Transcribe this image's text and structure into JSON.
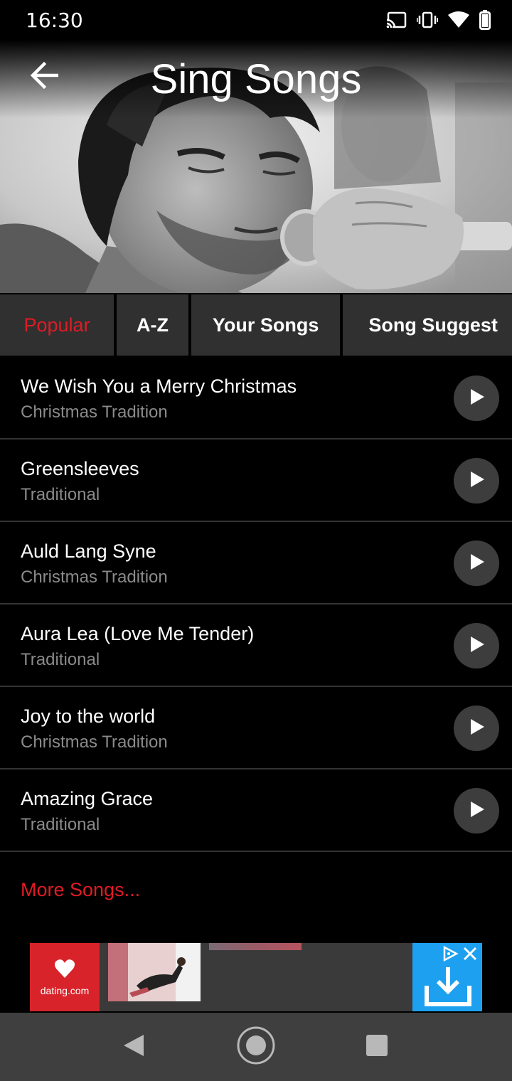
{
  "status_bar": {
    "time": "16:30",
    "icons": [
      "cast-icon",
      "vibrate-icon",
      "wifi-icon",
      "battery-icon"
    ]
  },
  "header": {
    "title": "Sing Songs",
    "back_icon": "arrow-back-icon"
  },
  "tabs": [
    {
      "label": "Popular",
      "active": true
    },
    {
      "label": "A-Z",
      "active": false
    },
    {
      "label": "Your Songs",
      "active": false
    },
    {
      "label": "Song Suggest",
      "active": false
    }
  ],
  "songs": [
    {
      "title": "We Wish You a Merry Christmas",
      "artist": "Christmas Tradition"
    },
    {
      "title": "Greensleeves",
      "artist": "Traditional"
    },
    {
      "title": "Auld Lang Syne",
      "artist": "Christmas Tradition"
    },
    {
      "title": "Aura Lea (Love Me Tender)",
      "artist": "Traditional"
    },
    {
      "title": "Joy to the world",
      "artist": "Christmas Tradition"
    },
    {
      "title": "Amazing Grace",
      "artist": "Traditional"
    }
  ],
  "more_songs_label": "More Songs...",
  "ad": {
    "brand": "dating.com"
  },
  "colors": {
    "accent": "#e01b24",
    "tab_bg": "#303030",
    "play_bg": "#3d3d3d",
    "nav_bg": "#3f3f3f"
  }
}
